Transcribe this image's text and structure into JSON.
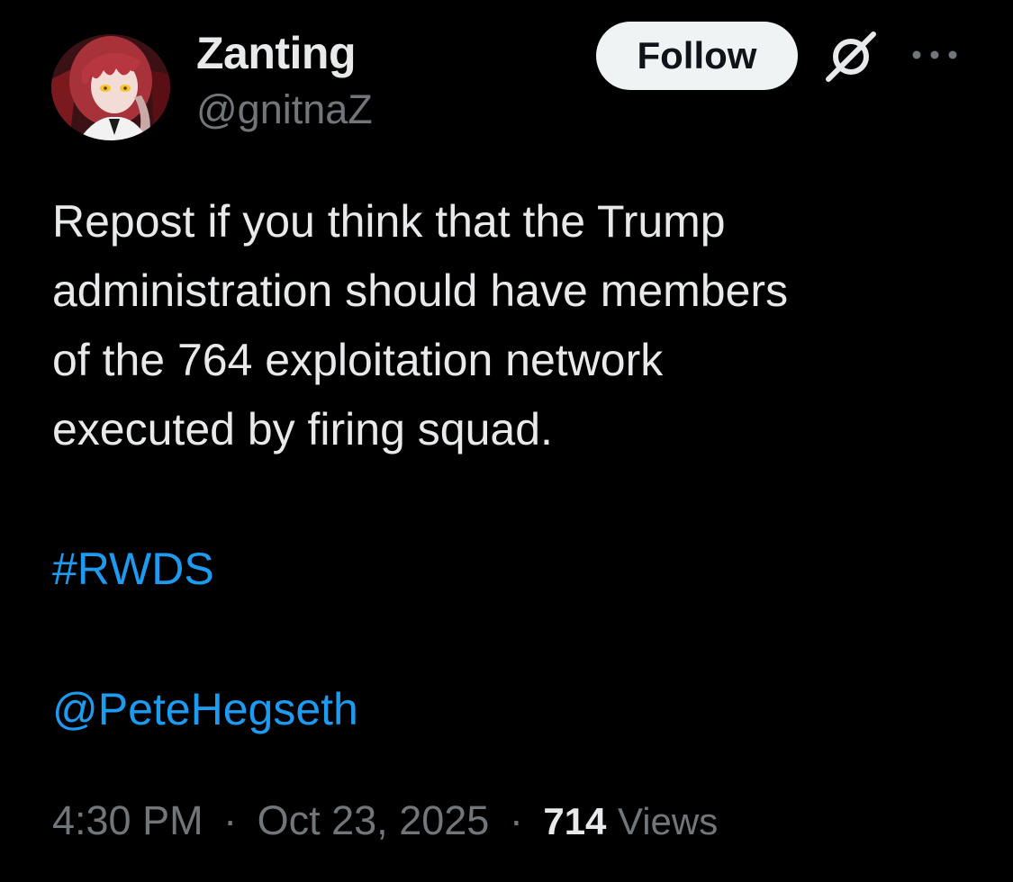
{
  "author": {
    "display_name": "Zanting",
    "handle": "@gnitnaZ",
    "avatar_icon": "anime-avatar"
  },
  "actions": {
    "follow_label": "Follow",
    "grok_icon": "grok-icon",
    "more_icon": "more-icon"
  },
  "tweet": {
    "text_lines": [
      "Repost if you think that the Trump",
      "administration should have members",
      "of the 764 exploitation network",
      "executed by firing squad."
    ],
    "hashtag": "#RWDS",
    "mention": "@PeteHegseth"
  },
  "meta": {
    "time": "4:30 PM",
    "separator": "·",
    "date": "Oct 23, 2025",
    "views_count": "714",
    "views_label": "Views"
  },
  "colors": {
    "background": "#000000",
    "text_primary": "#e7e9ea",
    "text_secondary": "#71767b",
    "link": "#1d9bf0",
    "follow_button_bg": "#eff3f4",
    "follow_button_text": "#0f1419"
  }
}
